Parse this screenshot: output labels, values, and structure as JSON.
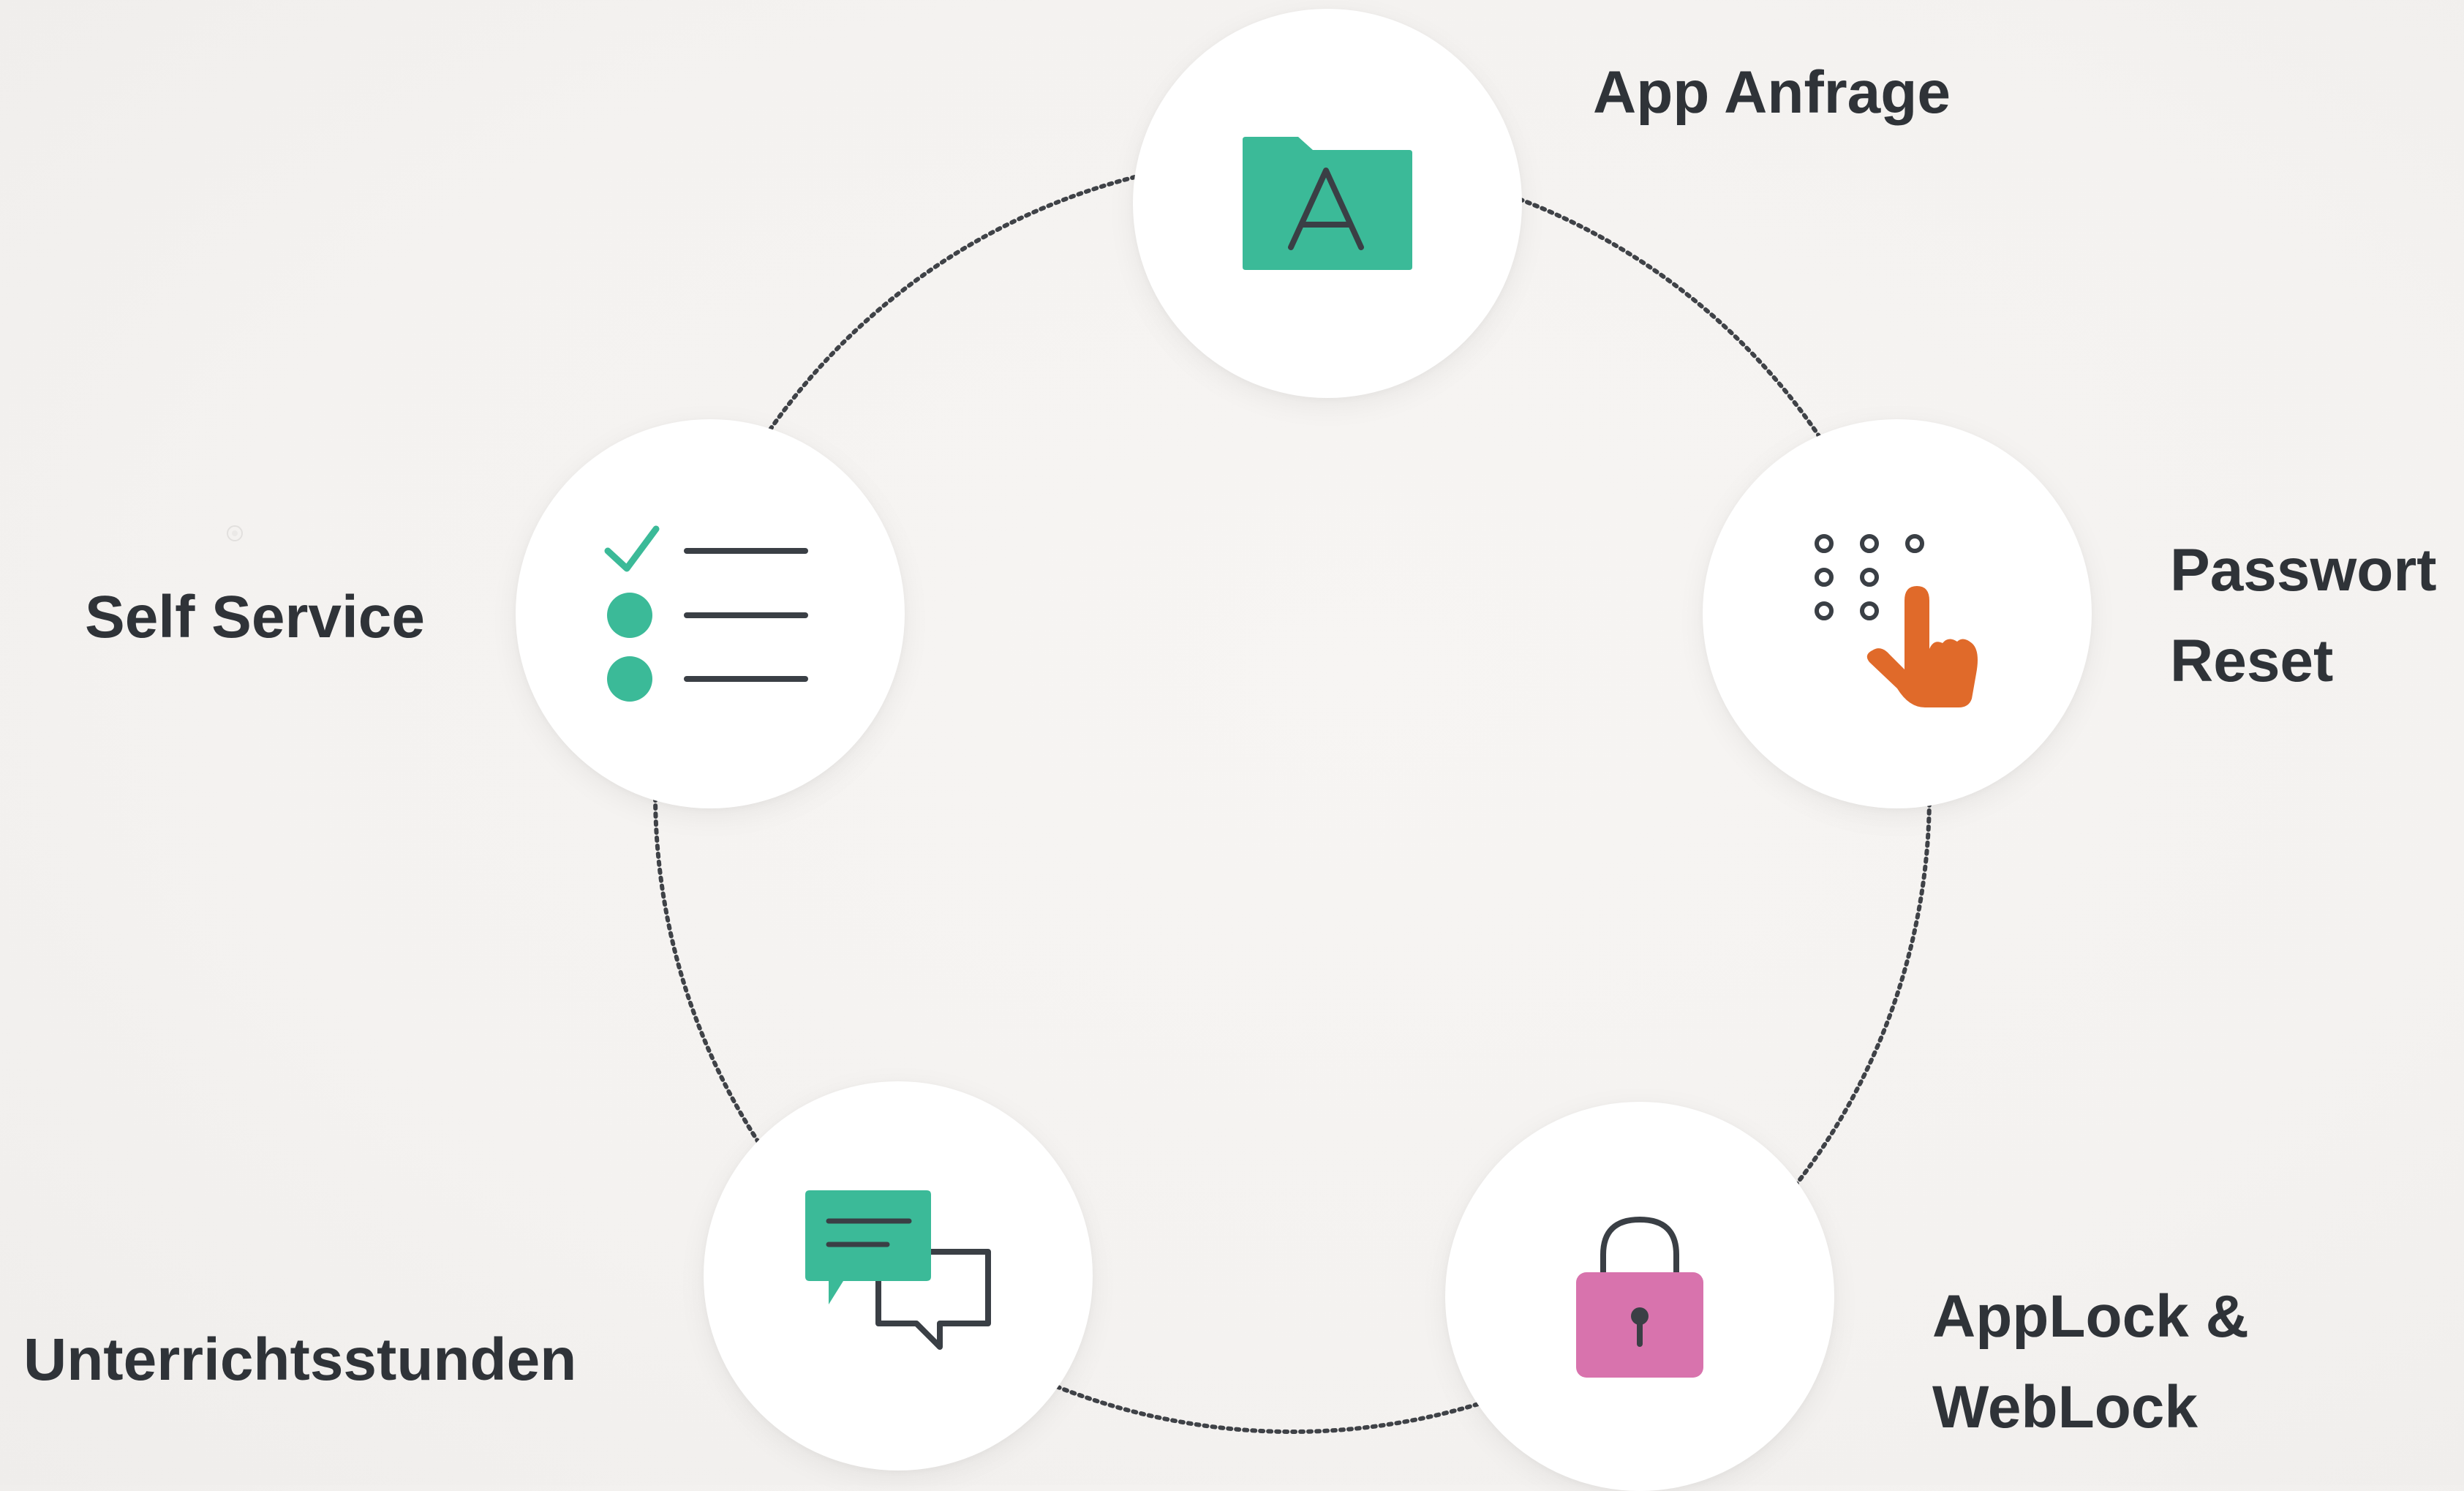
{
  "diagram": {
    "nodes": [
      {
        "id": "app-request",
        "label_lines": [
          "App Anfrage"
        ],
        "icon": "folder-letter-a-icon",
        "color": "#3bba98"
      },
      {
        "id": "password-reset",
        "label_lines": [
          "Passwort",
          "Reset"
        ],
        "icon": "keypad-tap-icon",
        "color": "#e06a2a"
      },
      {
        "id": "applock-weblock",
        "label_lines": [
          "AppLock &",
          "WebLock"
        ],
        "icon": "padlock-icon",
        "color": "#d873ad"
      },
      {
        "id": "lessons",
        "label_lines": [
          "Unterrichtsstunden"
        ],
        "icon": "chat-bubbles-icon",
        "color": "#3bba98"
      },
      {
        "id": "self-service",
        "label_lines": [
          "Self Service"
        ],
        "icon": "checklist-icon",
        "color": "#3bba98"
      }
    ],
    "colors": {
      "text": "#2f3338",
      "icon_dark": "#3a3f45",
      "ring": "#3f4247"
    }
  }
}
